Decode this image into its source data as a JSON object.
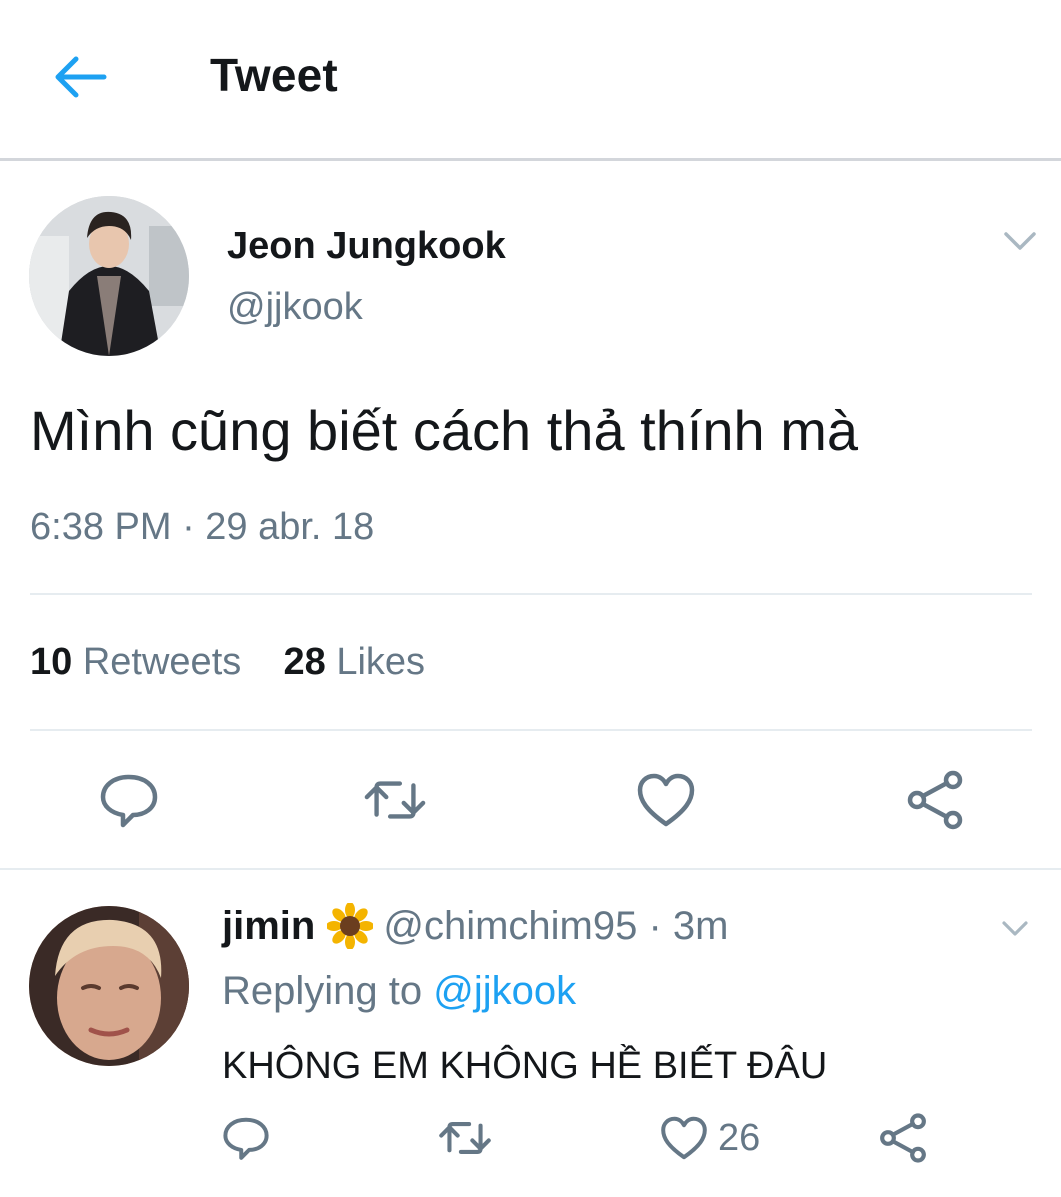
{
  "header": {
    "title": "Tweet",
    "back_icon": "arrow-left-icon"
  },
  "tweet": {
    "display_name": "Jeon Jungkook",
    "handle": "@jjkook",
    "text": "Mình cũng biết cách thả thính mà",
    "timestamp": "6:38 PM · 29 abr. 18",
    "retweets_count": "10",
    "retweets_label": "Retweets",
    "likes_count": "28",
    "likes_label": "Likes",
    "actions": [
      "reply-icon",
      "retweet-icon",
      "heart-icon",
      "share-icon"
    ]
  },
  "reply": {
    "display_name": "jimin",
    "badge_icon": "sunflower-icon",
    "handle_time": "@chimchim95 · 3m",
    "replying_prefix": "Replying to",
    "replying_to": "@jjkook",
    "text": "KHÔNG EM KHÔNG HỀ BIẾT ĐÂU",
    "like_count": "26",
    "actions": [
      "reply-icon",
      "retweet-icon",
      "heart-icon",
      "share-icon"
    ]
  },
  "colors": {
    "accent": "#1da1f2",
    "secondary_text": "#657786",
    "primary_text": "#14171a",
    "divider": "#e6ecf0"
  }
}
